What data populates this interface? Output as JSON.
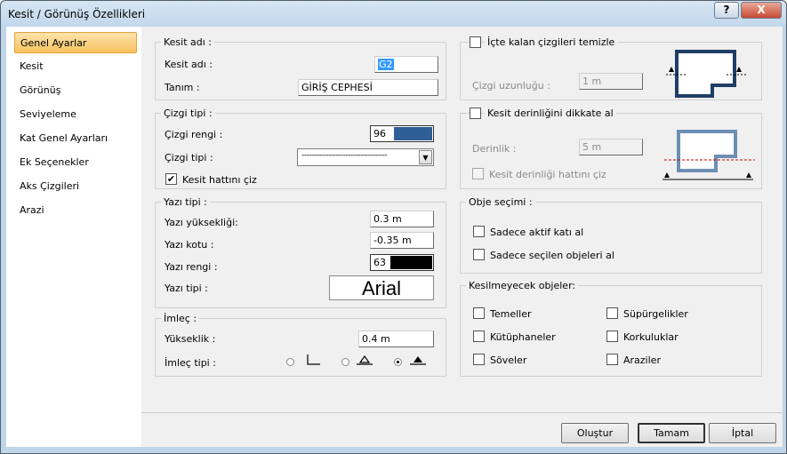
{
  "window": {
    "title": "Kesit / Görünüş Özellikleri",
    "help_label": "?",
    "close_label": "X"
  },
  "sidebar": {
    "items": [
      {
        "label": "Genel Ayarlar",
        "active": true
      },
      {
        "label": "Kesit"
      },
      {
        "label": "Görünüş"
      },
      {
        "label": "Seviyeleme"
      },
      {
        "label": "Kat Genel Ayarları"
      },
      {
        "label": "Ek Seçenekler"
      },
      {
        "label": "Aks Çizgileri"
      },
      {
        "label": "Arazi"
      }
    ]
  },
  "kesit_adi": {
    "legend": "Kesit adı :",
    "name_label": "Kesit adı :",
    "name_value": "G2",
    "desc_label": "Tanım :",
    "desc_value": "GİRİŞ CEPHESİ"
  },
  "cizgi_tipi": {
    "legend": "Çizgi tipi :",
    "color_label": "Çizgi rengi :",
    "color_value": "96",
    "color_hex": "#2f5f96",
    "type_label": "Çizgi tipi :",
    "type_value": "-----------------------------------",
    "checkbox_label": "Kesit hattını çiz",
    "checkbox_checked": true
  },
  "yazi_tipi": {
    "legend": "Yazı tipi :",
    "height_label": "Yazı yüksekliği:",
    "height_value": "0.3 m",
    "level_label": "Yazı kotu :",
    "level_value": "-0.35 m",
    "color_label": "Yazı rengi :",
    "color_value": "63",
    "color_hex": "#000000",
    "font_label": "Yazı tipi :",
    "font_value": "Arial"
  },
  "imlec": {
    "legend": "İmleç :",
    "height_label": "Yükseklik :",
    "height_value": "0.4 m",
    "type_label": "İmleç tipi :",
    "selected_index": 2
  },
  "icte_kalan": {
    "checkbox_label": "İçte kalan çizgileri temizle",
    "checked": false,
    "length_label": "Çizgi uzunluğu :",
    "length_value": "1 m"
  },
  "kesit_derinligi": {
    "checkbox_label": "Kesit derinliğini dikkate al",
    "checked": false,
    "depth_label": "Derinlik :",
    "depth_value": "5 m",
    "line_label": "Kesit derinliği hattını çiz"
  },
  "obje_secimi": {
    "legend": "Obje seçimi :",
    "opt1": "Sadece aktif  katı al",
    "opt2": "Sadece seçilen objeleri al"
  },
  "kesilmeyecek": {
    "legend": "Kesilmeyecek objeler:",
    "items": [
      "Temeller",
      "Süpürgelikler",
      "Kütüphaneler",
      "Korkuluklar",
      "Söveler",
      "Araziler"
    ]
  },
  "footer": {
    "create": "Oluştur",
    "ok": "Tamam",
    "cancel": "İptal"
  },
  "colors": {
    "accent_blue": "#2f5f96",
    "nav_active": "#f7c25f",
    "window_frame": "#bfd5ea"
  }
}
